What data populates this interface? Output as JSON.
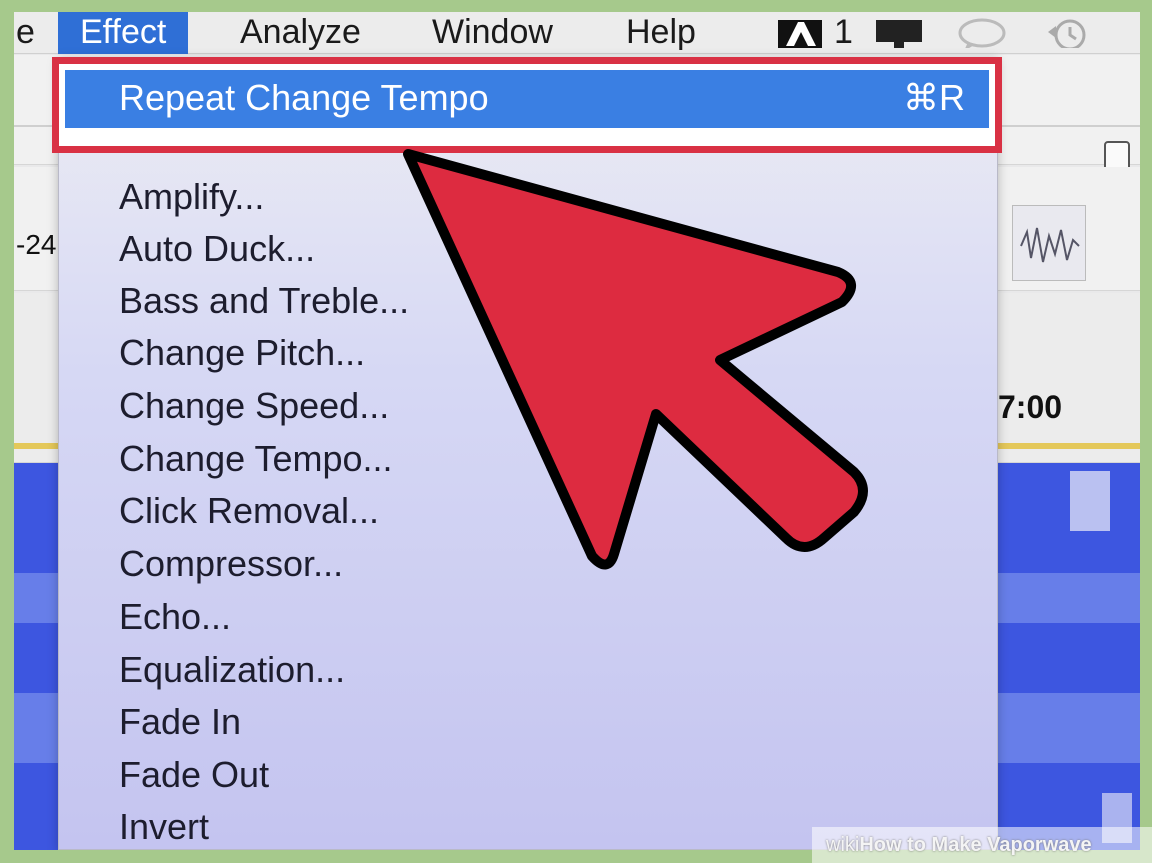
{
  "menubar": {
    "partial_item": "e",
    "items": [
      "Effect",
      "Analyze",
      "Window",
      "Help"
    ],
    "status_count": "1"
  },
  "ruler": {
    "left_value": "-24",
    "time_value": "7:00"
  },
  "effect_menu": {
    "repeat": {
      "label": "Repeat Change Tempo",
      "shortcut": "⌘R"
    },
    "items": [
      "Amplify...",
      "Auto Duck...",
      "Bass and Treble...",
      "Change Pitch...",
      "Change Speed...",
      "Change Tempo...",
      "Click Removal...",
      "Compressor...",
      "Echo...",
      "Equalization...",
      "Fade In",
      "Fade Out",
      "Invert"
    ]
  },
  "watermark": {
    "brand": "wiki",
    "text": "How to Make Vaporwave"
  },
  "colors": {
    "menu_highlight": "#3a7fe3",
    "callout_red": "#d93144",
    "waveform": "#3d56e0",
    "page_border": "#a6c98c"
  },
  "icons": [
    "adobe-icon",
    "display-icon",
    "chat-icon",
    "time-machine-icon",
    "arrow-callout-icon"
  ]
}
